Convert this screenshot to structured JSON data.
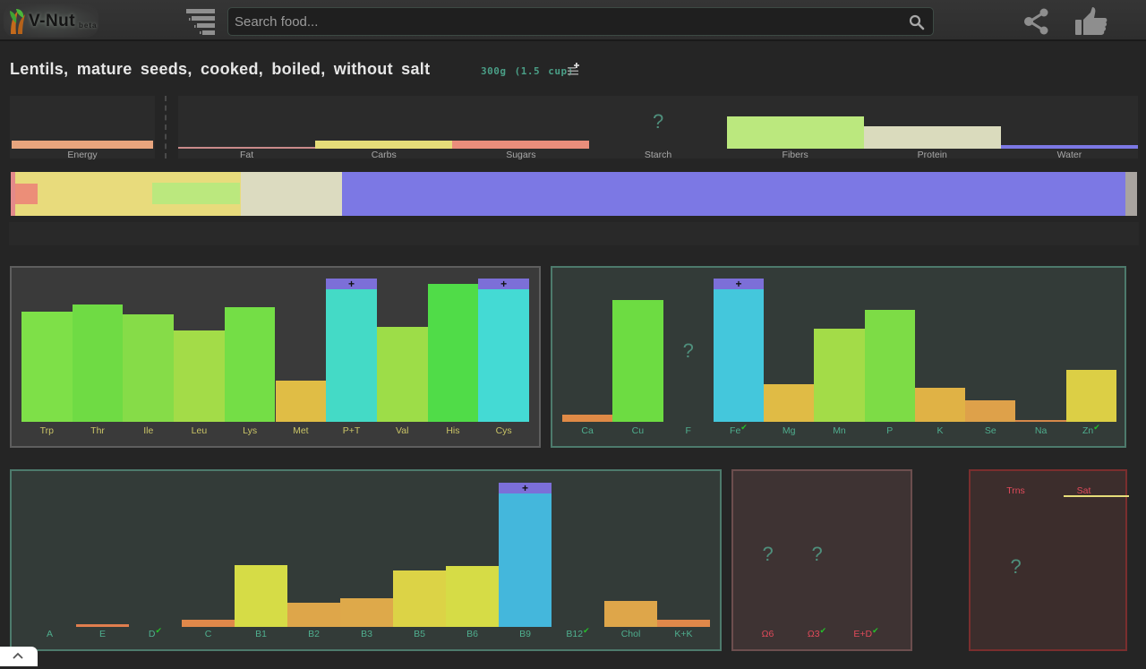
{
  "header": {
    "logo_text": "V-Nut",
    "logo_badge": "beta",
    "search_placeholder": "Search food...",
    "icons": [
      "logo-leaf-icon",
      "filter-sort-icon",
      "search-icon",
      "share-icon",
      "thumbs-up-icon"
    ]
  },
  "food": {
    "title": "Lentils, mature seeds, cooked, boiled, without salt",
    "portion": "300g (1.5 cup)",
    "portion_icon": "add-list-icon"
  },
  "macros": {
    "items": [
      {
        "label": "Energy",
        "value": 0.15,
        "color": "#e8a57e"
      },
      {
        "label": "Fat",
        "value": 0.02,
        "color": "#c98a8a"
      },
      {
        "label": "Carbs",
        "value": 0.16,
        "color": "#e6dd79"
      },
      {
        "label": "Sugars",
        "value": 0.16,
        "color": "#e98d7b"
      },
      {
        "label": "Starch",
        "value": null,
        "unknown": "?"
      },
      {
        "label": "Fibers",
        "value": 0.62,
        "color": "#bbe87e"
      },
      {
        "label": "Protein",
        "value": 0.43,
        "color": "#dadbbd"
      },
      {
        "label": "Water",
        "value": 0.07,
        "color": "#7c78e4"
      }
    ]
  },
  "composition_bar": {
    "segments": [
      {
        "name": "fat",
        "fraction": 0.004,
        "color": "#e38a8a"
      },
      {
        "name": "carbs",
        "fraction": 0.2,
        "color": "#e8db7c"
      },
      {
        "name": "protein",
        "fraction": 0.09,
        "color": "#dcdbc0"
      },
      {
        "name": "water",
        "fraction": 0.696,
        "color": "#7c78e4"
      },
      {
        "name": "other",
        "fraction": 0.01,
        "color": "#a9a4a0"
      }
    ],
    "inner": [
      {
        "name": "sugars",
        "fraction": 0.02,
        "color": "#ec8e78"
      },
      {
        "name": "fibers",
        "fraction": 0.078,
        "color": "#bbe87e"
      }
    ]
  },
  "amino_acids": {
    "label_color": "#c9c466",
    "bars": [
      {
        "label": "Trp",
        "value": 0.77,
        "color": "#7ee048"
      },
      {
        "label": "Thr",
        "value": 0.82,
        "color": "#6fdb44"
      },
      {
        "label": "Ile",
        "value": 0.75,
        "color": "#86dc48"
      },
      {
        "label": "Leu",
        "value": 0.64,
        "color": "#a3dc48"
      },
      {
        "label": "Lys",
        "value": 0.8,
        "color": "#74de46"
      },
      {
        "label": "Met",
        "value": 0.29,
        "color": "#e0bd45"
      },
      {
        "label": "P+T",
        "value": 1.0,
        "color": "#44dac6",
        "over": "+"
      },
      {
        "label": "Val",
        "value": 0.66,
        "color": "#9ddd48"
      },
      {
        "label": "His",
        "value": 0.96,
        "color": "#50dc48"
      },
      {
        "label": "Cys",
        "value": 1.0,
        "color": "#44dad4",
        "over": "+"
      }
    ]
  },
  "minerals": {
    "label_color": "#4fae8e",
    "bars": [
      {
        "label": "Ca",
        "value": 0.05,
        "color": "#e08a46"
      },
      {
        "label": "Cu",
        "value": 0.85,
        "color": "#6ddc42"
      },
      {
        "label": "F",
        "value": null,
        "unknown": "?"
      },
      {
        "label": "Fe",
        "value": 1.0,
        "color": "#44c7dc",
        "over": "+",
        "check": "✔"
      },
      {
        "label": "Mg",
        "value": 0.26,
        "color": "#e0bb45"
      },
      {
        "label": "Mn",
        "value": 0.65,
        "color": "#a3dc48"
      },
      {
        "label": "P",
        "value": 0.78,
        "color": "#7ddc46"
      },
      {
        "label": "K",
        "value": 0.24,
        "color": "#e0b245"
      },
      {
        "label": "Se",
        "value": 0.15,
        "color": "#dea14a"
      },
      {
        "label": "Na",
        "value": 0.01,
        "color": "#d6884a"
      },
      {
        "label": "Zn",
        "value": 0.36,
        "color": "#dccf45",
        "check": "✔"
      }
    ]
  },
  "vitamins": {
    "label_color": "#4fae8e",
    "bars": [
      {
        "label": "A",
        "value": 0.0,
        "color": "#e07a46"
      },
      {
        "label": "E",
        "value": 0.02,
        "color": "#e07e4e"
      },
      {
        "label": "D",
        "value": 0.0,
        "color": "#e07a46",
        "check": "✔"
      },
      {
        "label": "C",
        "value": 0.05,
        "color": "#e0884a"
      },
      {
        "label": "B1",
        "value": 0.43,
        "color": "#d6dc46"
      },
      {
        "label": "B2",
        "value": 0.17,
        "color": "#dea64a"
      },
      {
        "label": "B3",
        "value": 0.2,
        "color": "#dea94a"
      },
      {
        "label": "B5",
        "value": 0.39,
        "color": "#dcd346"
      },
      {
        "label": "B6",
        "value": 0.42,
        "color": "#d6dc46"
      },
      {
        "label": "B9",
        "value": 1.0,
        "color": "#44b7dc",
        "over": "+"
      },
      {
        "label": "B12",
        "value": 0.0,
        "color": "#e07a46",
        "check": "✔"
      },
      {
        "label": "Chol",
        "value": 0.18,
        "color": "#dea64a"
      },
      {
        "label": "K+K",
        "value": 0.05,
        "color": "#e0884a"
      }
    ]
  },
  "fatty_acids": {
    "label_color": "#e04a5a",
    "bars": [
      {
        "label": "Ω6",
        "value": null,
        "unknown": "?"
      },
      {
        "label": "Ω3",
        "value": null,
        "unknown": "?",
        "check": "✔"
      },
      {
        "label": "E+D",
        "value": null,
        "check": "✔"
      }
    ]
  },
  "bad_fats": {
    "label_color": "#e04a5a",
    "bars": [
      {
        "label": "Trns",
        "value": null,
        "unknown": "?"
      },
      {
        "label": "Sat",
        "value": 0.01,
        "color": "#e6dd79"
      }
    ]
  },
  "scroll_top_icon": "chevron-up-icon"
}
